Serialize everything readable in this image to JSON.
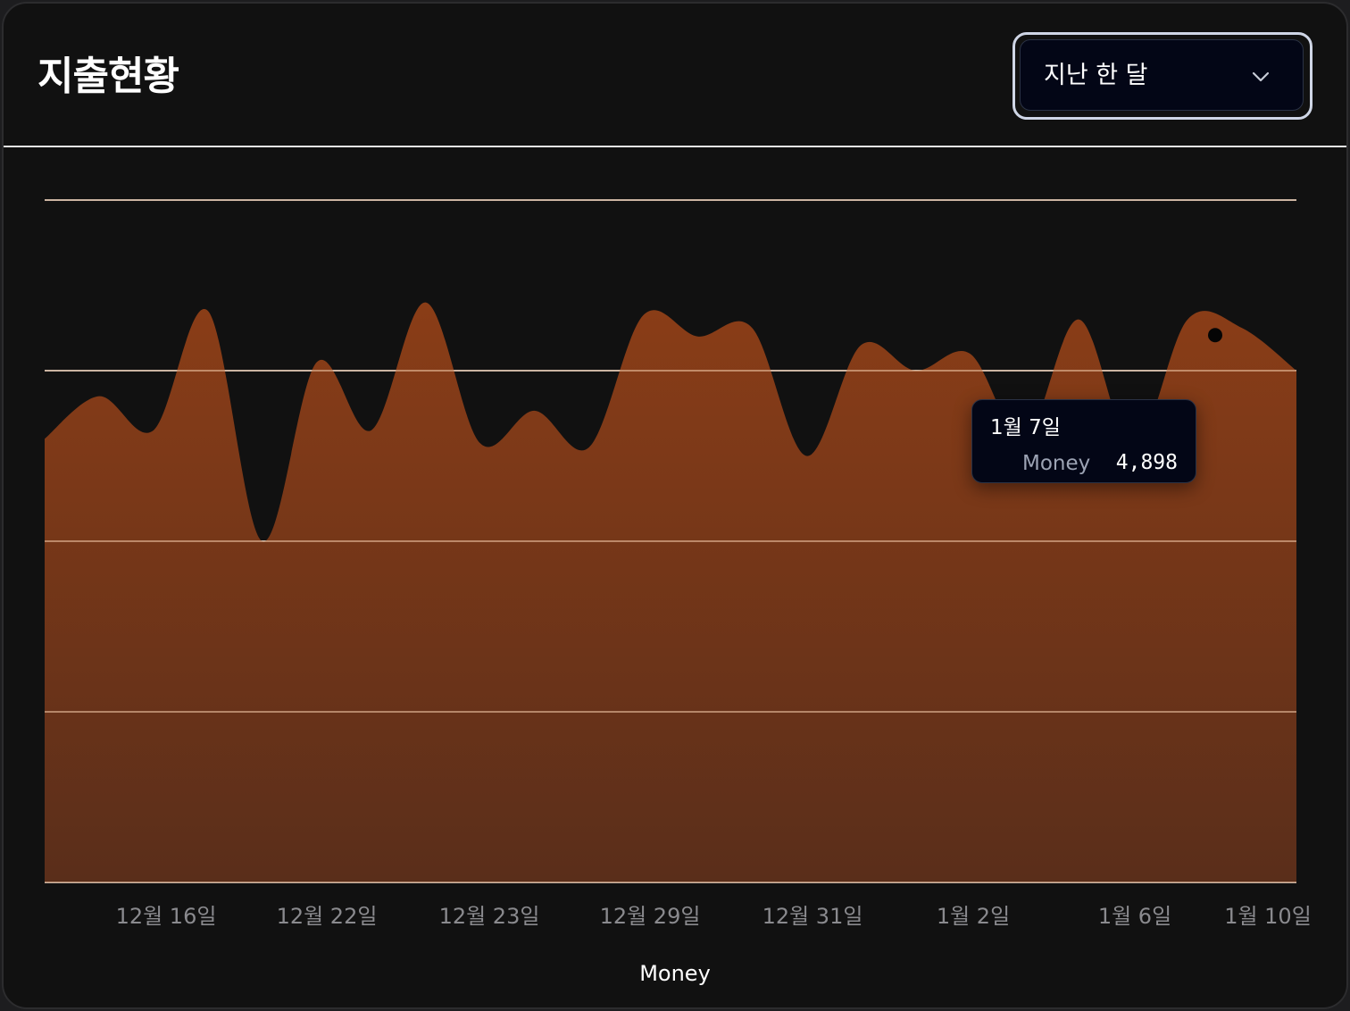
{
  "header": {
    "title": "지출현황",
    "range_select": {
      "selected": "지난 한 달"
    }
  },
  "chart_data": {
    "type": "area",
    "series": [
      {
        "name": "Money",
        "color": "#8a3d17",
        "values": [
          5200,
          5700,
          5300,
          6700,
          4000,
          6100,
          5300,
          6800,
          5150,
          5530,
          5100,
          6650,
          6400,
          6500,
          5000,
          6300,
          6000,
          6200,
          5200,
          6600,
          5100,
          6600,
          6500,
          6000
        ]
      }
    ],
    "x_ticks": [
      "12월 16일",
      "12월 22일",
      "12월 23일",
      "12월 29일",
      "12월 31일",
      "1월 2일",
      "1월 6일",
      "1월 10일"
    ],
    "xlabel": "Money",
    "ylabel": "",
    "ylim": [
      0,
      8000
    ],
    "grid": true,
    "legend": "none",
    "tooltip": {
      "date": "1월 7일",
      "series_name": "Money",
      "value": "4,898"
    }
  }
}
